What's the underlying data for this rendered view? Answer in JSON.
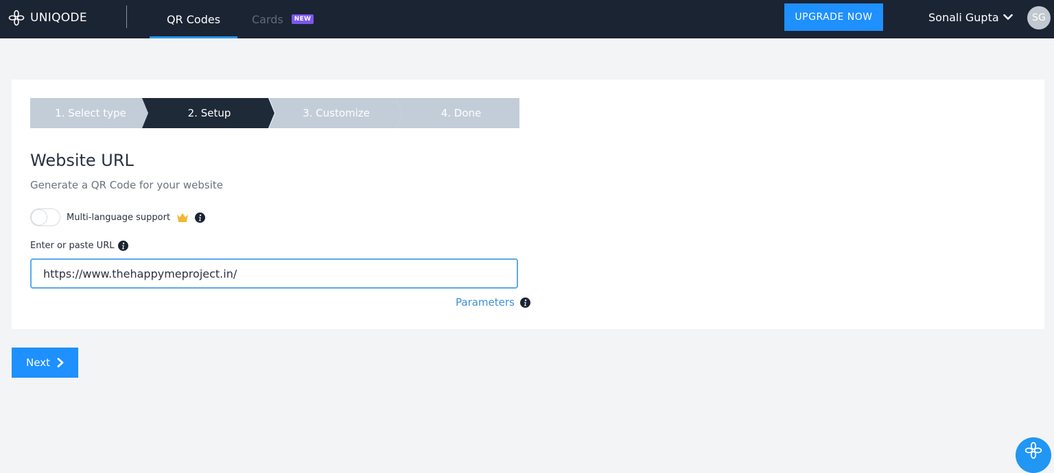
{
  "header": {
    "brand_name": "UNIQODE",
    "tabs": [
      {
        "label": "QR Codes",
        "active": true
      },
      {
        "label": "Cards",
        "badge": "NEW",
        "active": false
      }
    ],
    "upgrade_label": "UPGRADE NOW",
    "user_name": "Sonali Gupta",
    "avatar_initials": "SG"
  },
  "stepper": {
    "steps": [
      {
        "label": "1. Select type",
        "state": "done"
      },
      {
        "label": "2. Setup",
        "state": "active"
      },
      {
        "label": "3. Customize",
        "state": "pending"
      },
      {
        "label": "4. Done",
        "state": "pending"
      }
    ]
  },
  "form": {
    "title": "Website URL",
    "subtitle": "Generate a QR Code for your website",
    "toggle_label": "Multi-language support",
    "toggle_on": false,
    "url_label": "Enter or paste URL",
    "url_value": "https://www.thehappymeproject.in/",
    "params_label": "Parameters"
  },
  "actions": {
    "next_label": "Next"
  },
  "colors": {
    "topbar": "#1b2433",
    "accent": "#1e90ff",
    "step_active": "#1f2a38",
    "step_inactive": "#c3cdd8",
    "badge": "#7b57f0",
    "link": "#3b8fdc"
  },
  "icons": {
    "brand": "flower-logo-icon",
    "chevron": "chevron-down-icon",
    "info": "info-circle-icon",
    "crown": "crown-icon",
    "next": "chevron-right-icon",
    "help": "flower-help-icon"
  }
}
